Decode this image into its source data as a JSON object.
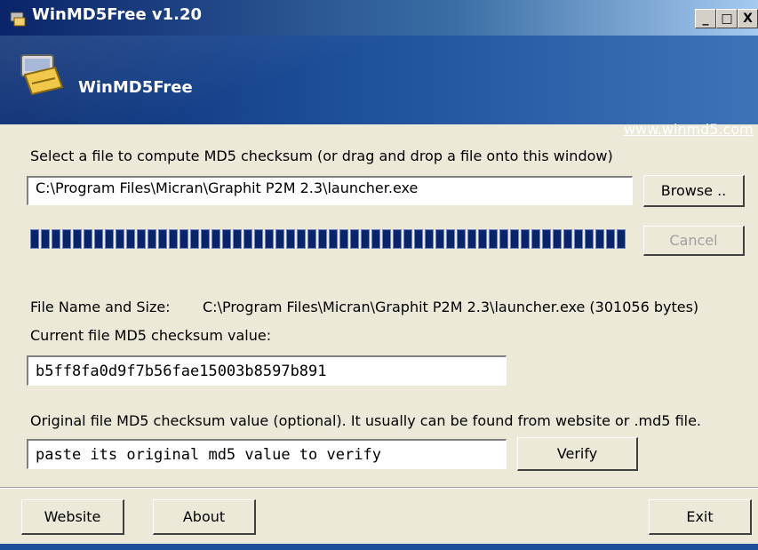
{
  "window": {
    "title": "WinMD5Free v1.20",
    "controls": {
      "minimize": "_",
      "maximize": "□",
      "close": "X"
    }
  },
  "banner": {
    "app_name": "WinMD5Free",
    "website_link": "www.winmd5.com"
  },
  "select_file": {
    "label": "Select a file to compute MD5 checksum (or drag and drop a file onto this window)",
    "path_value": "C:\\Program Files\\Micran\\Graphit P2M 2.3\\launcher.exe",
    "browse_label": "Browse ..",
    "cancel_label": "Cancel"
  },
  "progress": {
    "value": 1.0
  },
  "file_info": {
    "name_size_label": "File Name and Size:",
    "name_size_value": "C:\\Program Files\\Micran\\Graphit P2M 2.3\\launcher.exe (301056 bytes)",
    "current_md5_label": "Current file MD5 checksum value:",
    "current_md5_value": "b5ff8fa0d9f7b56fae15003b8597b891"
  },
  "verify": {
    "label": "Original file MD5 checksum value (optional). It usually can be found from website or .md5 file.",
    "placeholder": "paste its original md5 value to verify",
    "button_label": "Verify"
  },
  "footer": {
    "website_label": "Website",
    "about_label": "About",
    "exit_label": "Exit"
  },
  "colors": {
    "title_bar": "#0A246A",
    "banner": "#1E4F9A",
    "progress_fill": "#0A246A",
    "window_bg": "#ECE9D8"
  }
}
